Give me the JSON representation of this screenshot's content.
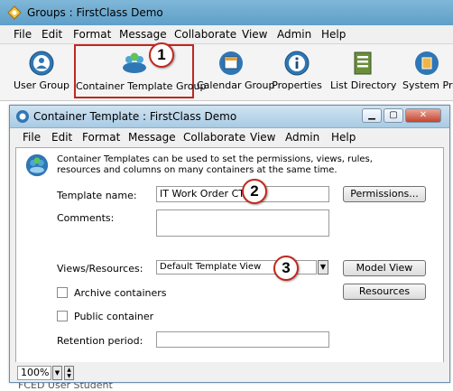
{
  "outer": {
    "title": "Groups : FirstClass Demo",
    "menu": [
      "File",
      "Edit",
      "Format",
      "Message",
      "Collaborate",
      "View",
      "Admin",
      "Help"
    ],
    "toolbar": [
      "User Group",
      "Container Template Group",
      "Calendar Group",
      "Properties",
      "List Directory",
      "System Pro"
    ],
    "behind_text": "FCED User Student"
  },
  "callouts": [
    "1",
    "2",
    "3"
  ],
  "inner": {
    "title": "Container Template : FirstClass Demo",
    "menu": [
      "File",
      "Edit",
      "Format",
      "Message",
      "Collaborate",
      "View",
      "Admin",
      "Help"
    ],
    "description": "Container Templates can be used to set the permissions, views, rules, resources and columns on many containers at the same time.",
    "template_name_label": "Template name:",
    "template_name_value": "IT Work Order CT",
    "permissions_button": "Permissions...",
    "comments_label": "Comments:",
    "views_label": "Views/Resources:",
    "views_value": "Default Template View",
    "model_view_button": "Model View",
    "resources_button": "Resources",
    "archive_label": "Archive containers",
    "public_label": "Public container",
    "retention_label": "Retention period:",
    "zoom": "100%"
  },
  "colors": {
    "accent": "#c0281e",
    "title_bar": "#6aa9d0"
  }
}
